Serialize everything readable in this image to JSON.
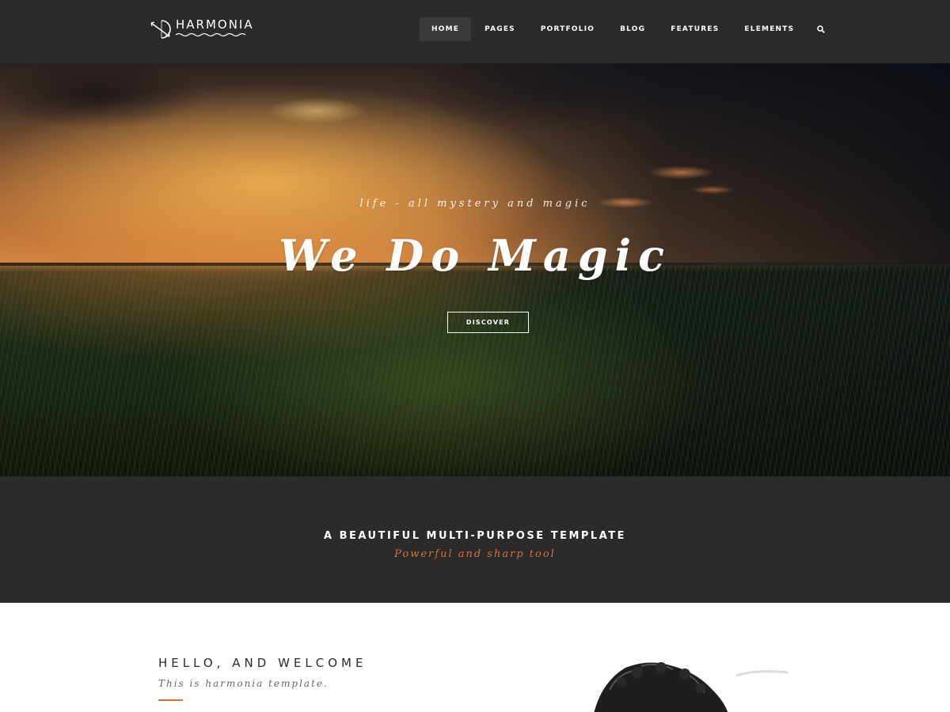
{
  "header": {
    "logo_text": "HARMONIA",
    "logo_icon": "bow-arrow-icon",
    "nav": [
      {
        "label": "HOME",
        "active": true
      },
      {
        "label": "PAGES",
        "active": false
      },
      {
        "label": "PORTFOLIO",
        "active": false
      },
      {
        "label": "BLOG",
        "active": false
      },
      {
        "label": "FEATURES",
        "active": false
      },
      {
        "label": "ELEMENTS",
        "active": false
      }
    ],
    "search_icon": "search-icon"
  },
  "hero": {
    "tagline": "life - all mystery and magic",
    "title": "We Do Magic",
    "button_label": "DISCOVER"
  },
  "banner": {
    "title": "A BEAUTIFUL MULTI-PURPOSE TEMPLATE",
    "subtitle": "Powerful and sharp tool"
  },
  "welcome": {
    "title": "HELLO, AND WELCOME",
    "subtitle": "This is harmonia template."
  },
  "colors": {
    "header_bg": "#2b2b2b",
    "accent": "#d3733a",
    "text_light": "#ffffff"
  }
}
